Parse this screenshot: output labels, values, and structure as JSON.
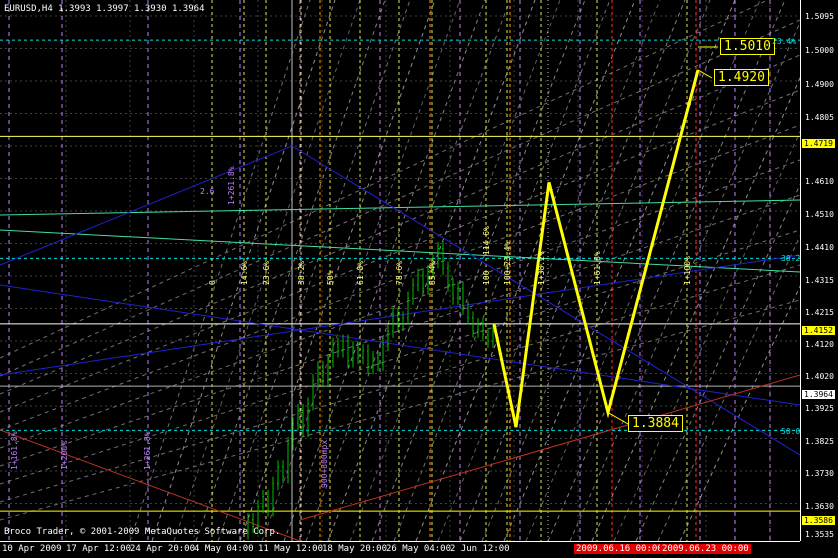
{
  "title": "EURUSD,H4  1.3993 1.3997 1.3930 1.3964",
  "copyright": "Broco Trader, © 2001-2009 MetaQuotes Software Corp.",
  "colors": {
    "background": "#000000",
    "candles": "#00c000",
    "projection": "#ffff00",
    "cyan": "#00e0e0",
    "blue": "#2020d0",
    "red_line": "#c03020",
    "fib_violet": "#c080ff",
    "fib_yellow": "#ffff80",
    "vline_red": "#ff3030",
    "vline_orange": "#ffa000"
  },
  "price_axis": {
    "ticks": [
      "1.5095",
      "1.5000",
      "1.4900",
      "1.4805",
      "1.4705",
      "1.4610",
      "1.4510",
      "1.4410",
      "1.4315",
      "1.4215",
      "1.4120",
      "1.4020",
      "1.3925",
      "1.3825",
      "1.3730",
      "1.3630",
      "1.3535"
    ],
    "tags": [
      {
        "label": "1.4719",
        "style": "yellow"
      },
      {
        "label": "1.4152",
        "style": "yellow"
      },
      {
        "label": "1.3964",
        "style": "white"
      },
      {
        "label": "1.3586",
        "style": "yellow"
      }
    ]
  },
  "time_axis": {
    "ticks": [
      "10 Apr 2009",
      "17 Apr 12:00",
      "24 Apr 20:00",
      "4 May 04:00",
      "11 May 12:00",
      "18 May 20:00",
      "26 May 04:00",
      "2 Jun 12:00"
    ],
    "tags": [
      "2009.06.16 00:00",
      "2009.06.23 00:00"
    ]
  },
  "callouts": [
    "1.5010",
    "1.4920",
    "1.3884"
  ],
  "fib_labels": {
    "right_cyan": [
      "23.4%",
      "38.2",
      "50.0"
    ],
    "vertical_yellow": [
      "0",
      "14.6%",
      "23.6%",
      "38.2%",
      "50%",
      "61.8%",
      "78.6%",
      "85.4%",
      "100",
      "114.6%",
      "100+23.4%",
      "1+38.2%",
      "1+61.8%",
      "1+100%"
    ],
    "violet": [
      "2.6",
      "1+261.8%",
      "1+161.8%",
      "1+261.8%",
      "1+200%",
      "900+800mpx"
    ]
  },
  "chart_data": {
    "type": "candlestick",
    "symbol": "EURUSD",
    "timeframe": "H4",
    "ohlc_last": {
      "open": 1.3993,
      "high": 1.3997,
      "low": 1.393,
      "close": 1.3964
    },
    "ylim": [
      1.3535,
      1.5095
    ],
    "projection_wave": [
      1.4152,
      1.384,
      1.458,
      1.3884,
      1.492
    ]
  }
}
